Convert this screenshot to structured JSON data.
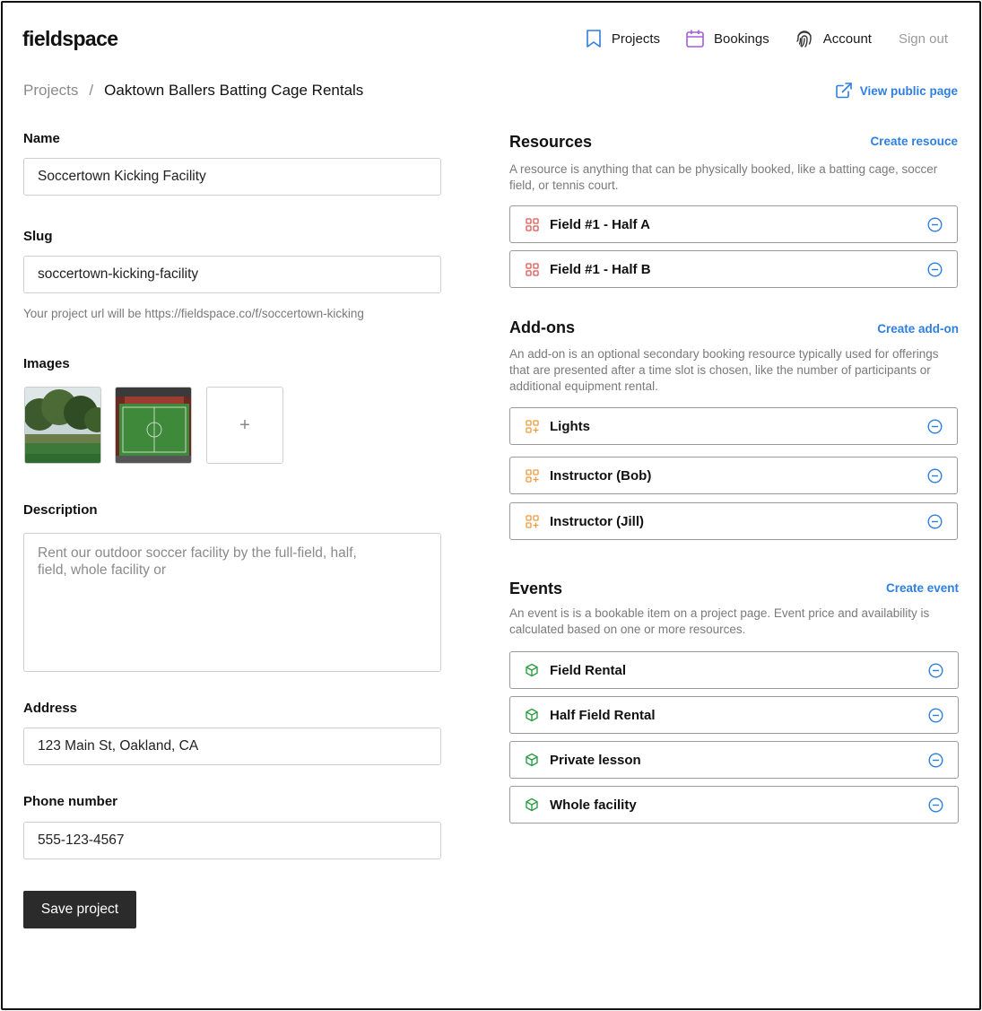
{
  "brand": {
    "logo": "fieldspace"
  },
  "nav": {
    "projects": "Projects",
    "bookings": "Bookings",
    "account": "Account",
    "signout": "Sign out"
  },
  "breadcrumb": {
    "root": "Projects",
    "separator": "/",
    "current": "Oaktown Ballers Batting Cage Rentals"
  },
  "view_public": "View public page",
  "form": {
    "name_label": "Name",
    "name_value": "Soccertown Kicking Facility",
    "slug_label": "Slug",
    "slug_value": "soccertown-kicking-facility",
    "slug_hint": "Your project url will be https://fieldspace.co/f/soccertown-kicking",
    "images_label": "Images",
    "add_image": "+",
    "description_label": "Description",
    "description_value": "Rent our outdoor soccer facility by the full-field, half, field, whole facility or",
    "address_label": "Address",
    "address_value": "123 Main St, Oakland, CA",
    "phone_label": "Phone number",
    "phone_value": "555-123-4567",
    "save_label": "Save project"
  },
  "resources": {
    "title": "Resources",
    "create": "Create resouce",
    "description": "A resource is anything that can be physically booked, like a batting cage, soccer field, or tennis court.",
    "items": [
      "Field #1 - Half A",
      "Field #1 - Half B"
    ]
  },
  "addons": {
    "title": "Add-ons",
    "create": "Create add-on",
    "description": "An add-on is an optional secondary booking resource typically used for offerings that are presented after a time slot is chosen, like the number of participants or additional equipment rental.",
    "items": [
      "Lights",
      "Instructor (Bob)",
      "Instructor (Jill)"
    ]
  },
  "events": {
    "title": "Events",
    "create": "Create event",
    "description": "An event is is a bookable item on a project page. Event price and availability is calculated based on one or more resources.",
    "items": [
      "Field Rental",
      "Half Field Rental",
      "Private lesson",
      "Whole facility"
    ]
  },
  "colors": {
    "link": "#2d7fe0",
    "resource_icon": "#e05555",
    "addon_icon": "#ef9a3c",
    "event_icon": "#2e9e44",
    "bookings_icon": "#a45ed6",
    "projects_icon": "#2d7fe0",
    "save_button": "#2b2b2b"
  },
  "icons": {
    "projects": "bookmark-icon",
    "bookings": "calendar-icon",
    "account": "fingerprint-icon",
    "public_page": "external-link-icon",
    "resource": "grid-icon",
    "addon": "grid-plus-icon",
    "event": "cube-icon",
    "remove": "minus-circle-icon"
  }
}
